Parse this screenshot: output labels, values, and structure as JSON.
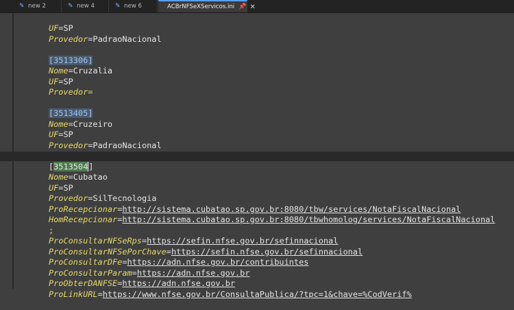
{
  "tabs": [
    {
      "label": "new 2"
    },
    {
      "label": "new 4"
    },
    {
      "label": "new 6"
    },
    {
      "label": "ACBrNFSeXServicos.ini",
      "pin": "📌",
      "close": "✕"
    }
  ],
  "editor": {
    "lines": [
      {
        "k": "UF",
        "eq": "=",
        "v": "SP"
      },
      {
        "k": "Provedor",
        "eq": "=",
        "v": "PadraoNacional"
      },
      {
        "sec_open": "[",
        "sec_body": "3513306",
        "sec_close": "]"
      },
      {
        "k": "Nome",
        "eq": "=",
        "v": "Cruzalia"
      },
      {
        "k": "UF",
        "eq": "=",
        "v": "SP"
      },
      {
        "k": "Provedor",
        "eq": "=",
        "v": ""
      },
      {
        "sec_open": "[",
        "sec_body": "3513405",
        "sec_close": "]"
      },
      {
        "k": "Nome",
        "eq": "=",
        "v": "Cruzeiro"
      },
      {
        "k": "UF",
        "eq": "=",
        "v": "SP"
      },
      {
        "k": "Provedor",
        "eq": "=",
        "v": "PadraoNacional"
      },
      {
        "sec_open": "[",
        "sec_a": "351350",
        "sec_b": "4",
        "sec_close": "]"
      },
      {
        "k": "Nome",
        "eq": "=",
        "v": "Cubatao"
      },
      {
        "k": "UF",
        "eq": "=",
        "v": "SP"
      },
      {
        "k": "Provedor",
        "eq": "=",
        "v": "SilTecnologia"
      },
      {
        "k": "ProRecepcionar",
        "eq": "=",
        "v": "http://sistema.cubatao.sp.gov.br:8080/tbw/services/NotaFiscalNacional"
      },
      {
        "k": "HomRecepcionar",
        "eq": "=",
        "v": "http://sistema.cubatao.sp.gov.br:8080/tbwhomolog/services/NotaFiscalNacional"
      },
      {
        "c": ";"
      },
      {
        "k": "ProConsultarNFSeRps",
        "eq": "=",
        "v": "https://sefin.nfse.gov.br/sefinnacional"
      },
      {
        "k": "ProConsultarNFSePorChave",
        "eq": "=",
        "v": "https://sefin.nfse.gov.br/sefinnacional"
      },
      {
        "k": "ProConsultarDFe",
        "eq": "=",
        "v": "https://adn.nfse.gov.br/contribuintes"
      },
      {
        "k": "ProConsultarParam",
        "eq": "=",
        "v": "https://adn.nfse.gov.br"
      },
      {
        "k": "ProObterDANFSE",
        "eq": "=",
        "v": "https://adn.nfse.gov.br"
      },
      {
        "k": "ProLinkURL",
        "eq": "=",
        "v": "https://www.nfse.gov.br/ConsultaPublica/?tpc=1&chave=%CodVerif%"
      }
    ]
  }
}
